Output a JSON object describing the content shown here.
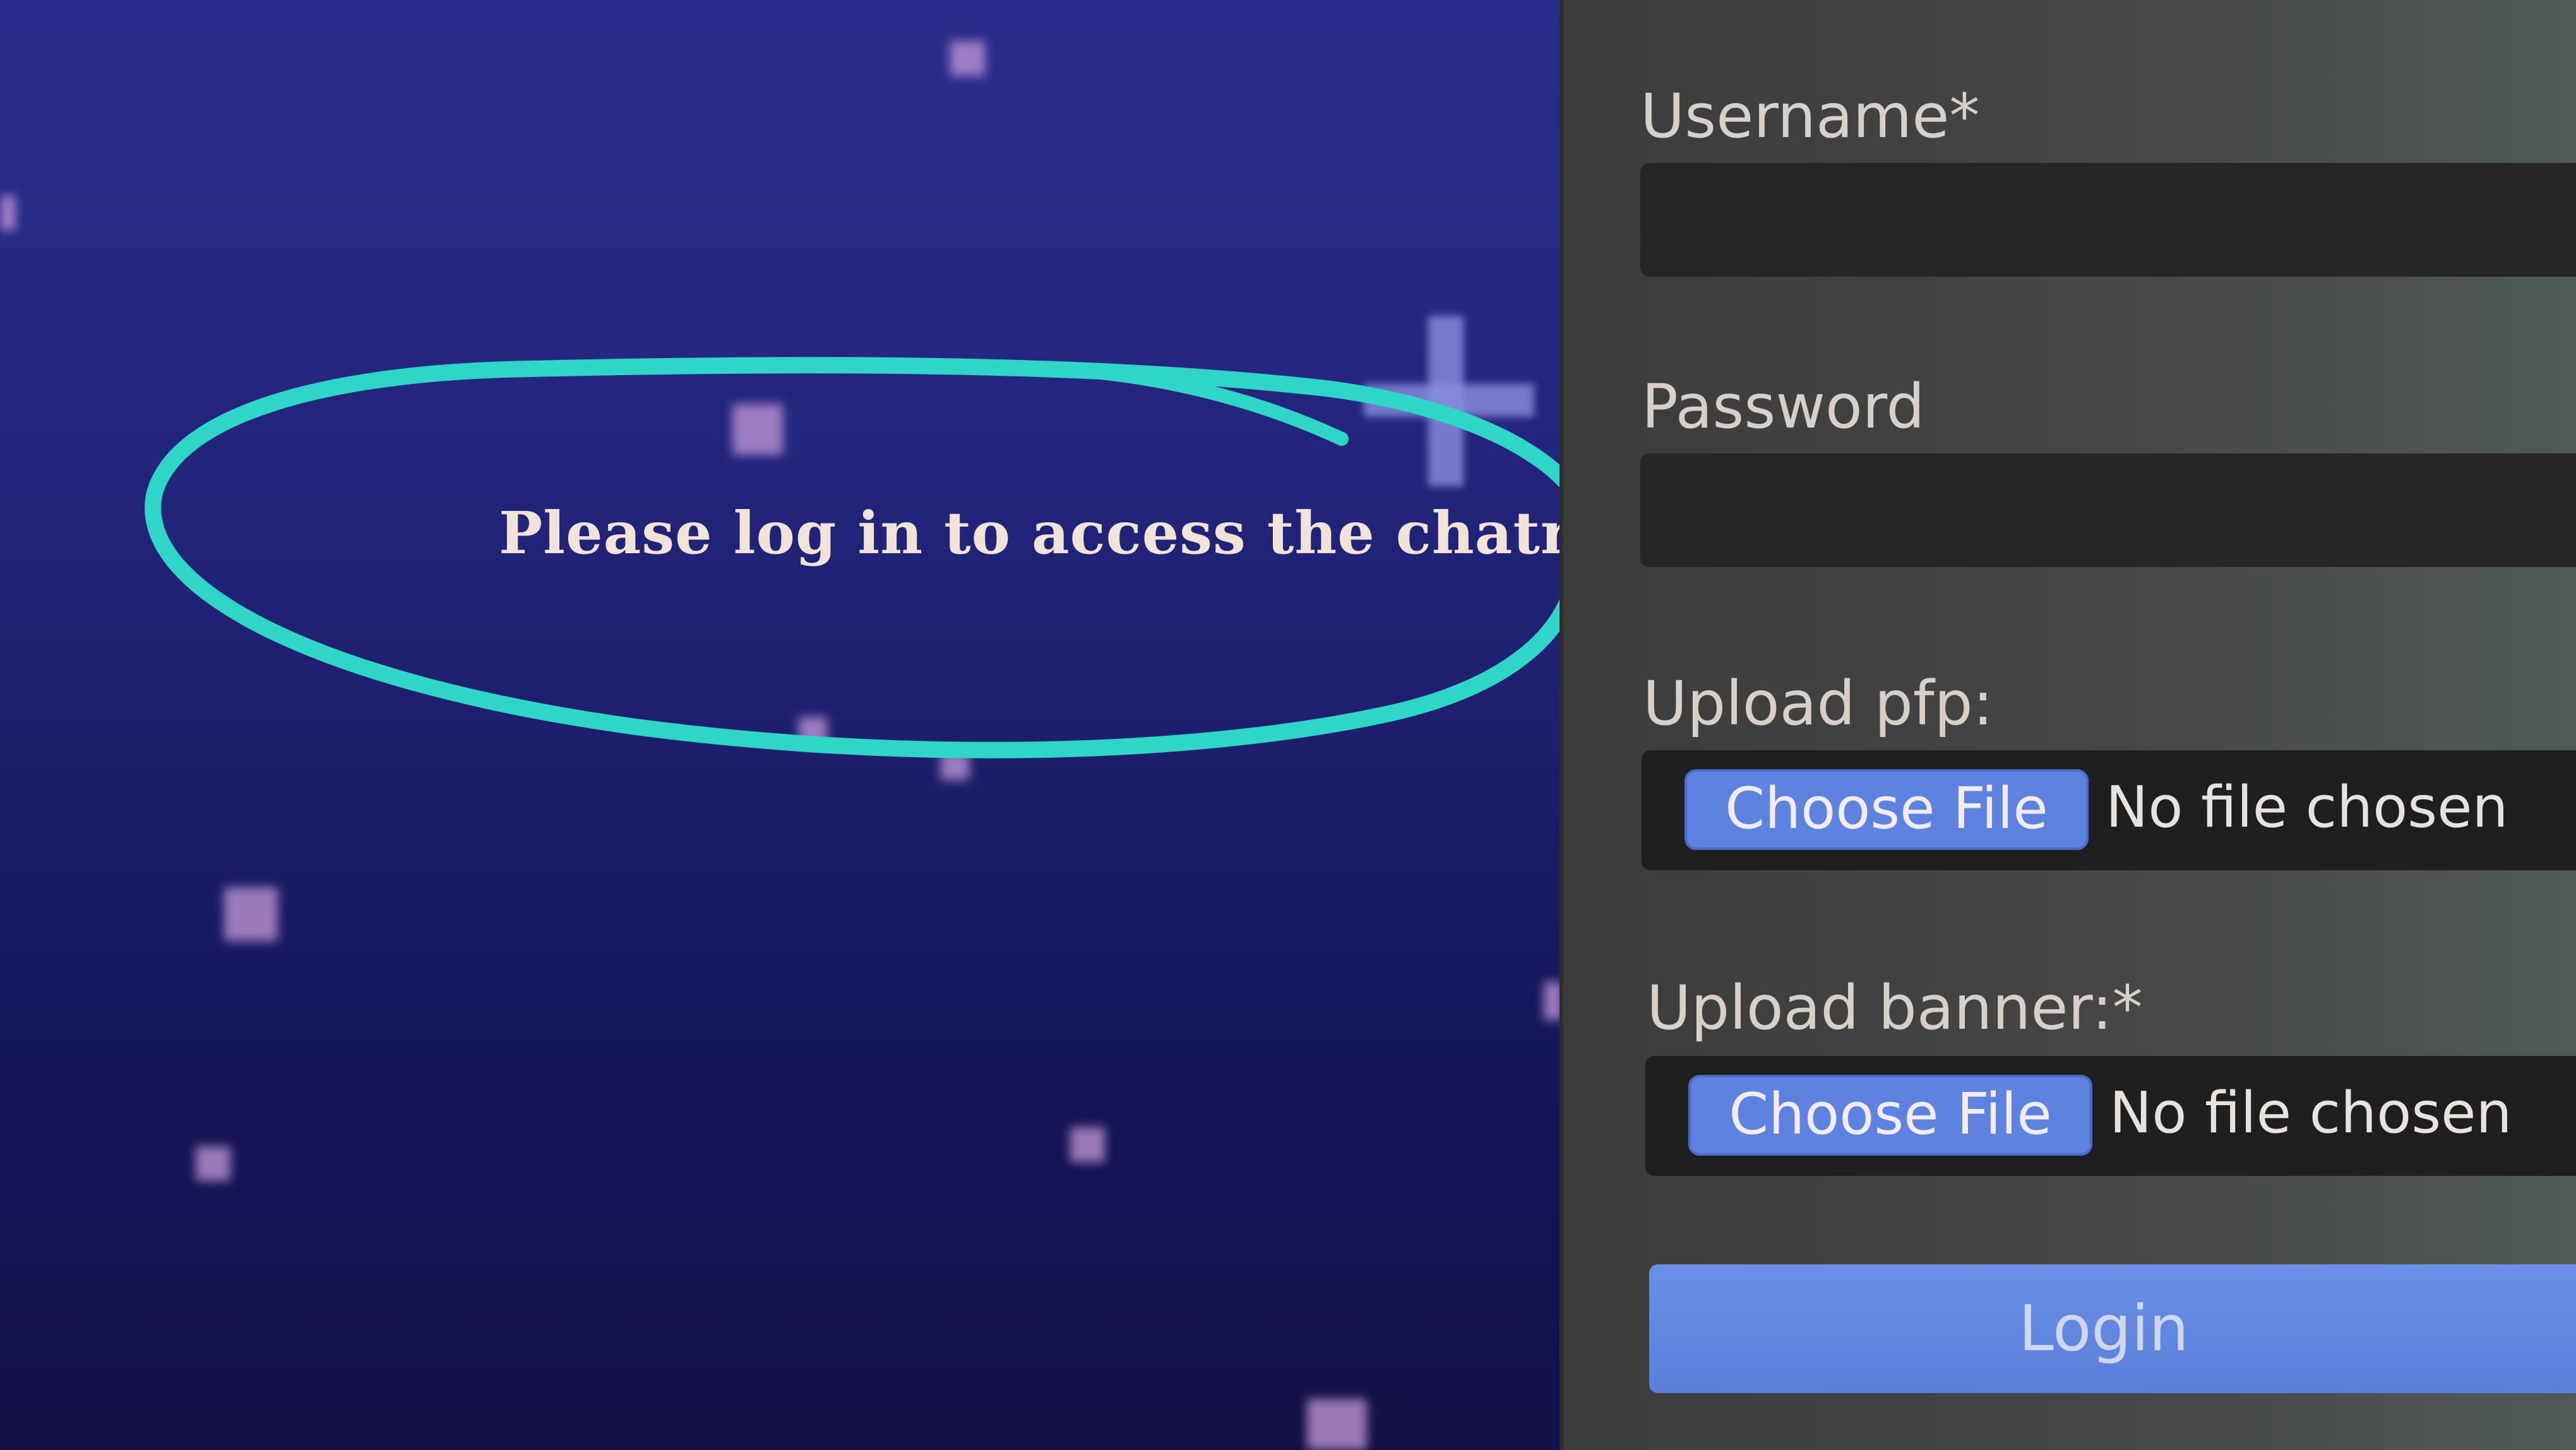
{
  "message": "Please log in to access the chatroom.",
  "form": {
    "username_label": "Username*",
    "password_label": "Password",
    "pfp_label": "Upload pfp:",
    "banner_label": "Upload banner:*",
    "choose_file_label": "Choose File",
    "no_file_text": "No file chosen",
    "login_label": "Login"
  },
  "colors": {
    "starfield_top": "#2b2d8e",
    "starfield_bottom": "#120f45",
    "panel": "#444444",
    "accent_button": "#5d82e0",
    "annotation": "#2fd6c8"
  }
}
